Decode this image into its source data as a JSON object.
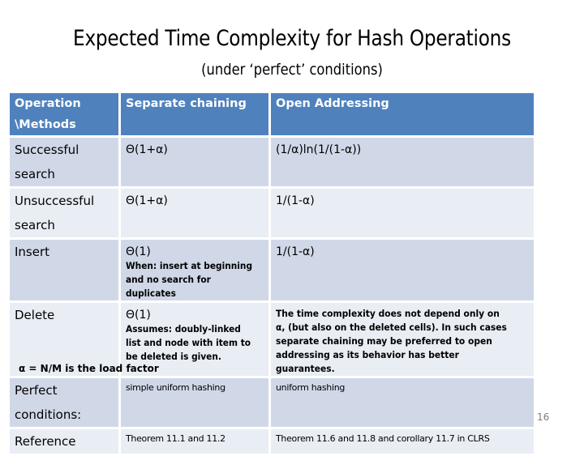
{
  "slide": {
    "title": "Expected Time Complexity for Hash Operations",
    "subtitle": "(under ‘perfect’ conditions)",
    "footnote": "α = N/M is the load factor",
    "page_number": "16"
  },
  "table": {
    "headers": [
      "Operation \\Methods",
      "Separate chaining",
      "Open Addressing"
    ],
    "rows": [
      {
        "operation": "Successful search",
        "separate_chaining": "Θ(1+α)",
        "open_addressing": "(1/α)ln(1/(1-α))"
      },
      {
        "operation": "Unsuccessful search",
        "separate_chaining": "Θ(1+α)",
        "open_addressing": "1/(1-α)"
      },
      {
        "operation": "Insert",
        "separate_chaining": "Θ(1)",
        "separate_chaining_note": "When: insert at beginning and no search for duplicates",
        "open_addressing": "1/(1-α)"
      },
      {
        "operation": "Delete",
        "separate_chaining": "Θ(1)",
        "separate_chaining_note": "Assumes: doubly-linked list and node with item to be deleted is given.",
        "open_addressing": "The time complexity does not depend only on α, (but also on the deleted cells). In such cases separate chaining may be preferred to open addressing as its behavior has better guarantees."
      },
      {
        "operation": "Perfect conditions:",
        "separate_chaining": "simple uniform hashing",
        "open_addressing": "uniform hashing"
      },
      {
        "operation": "Reference",
        "separate_chaining": "Theorem 11.1 and 11.2",
        "open_addressing": "Theorem 11.6 and 11.8 and corollary 11.7  in CLRS"
      }
    ]
  },
  "colors": {
    "header_bg": "#4f81bd",
    "row_odd_bg": "#d0d8e8",
    "row_even_bg": "#e9edf4"
  }
}
